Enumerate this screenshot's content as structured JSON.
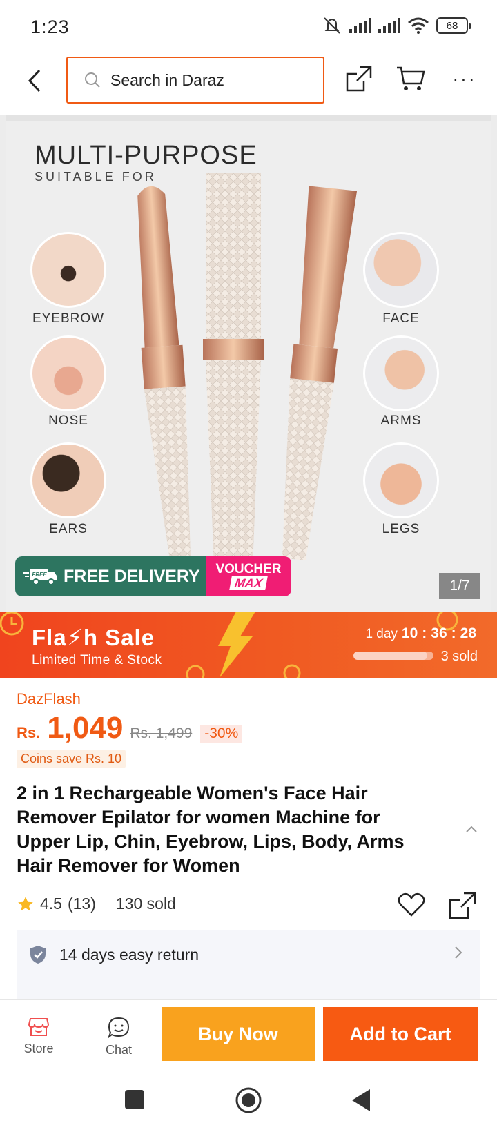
{
  "status_bar": {
    "time": "1:23",
    "battery": "68",
    "icons": [
      "mute-icon",
      "signal-icon",
      "signal-icon",
      "wifi-icon",
      "battery-icon"
    ]
  },
  "search": {
    "placeholder": "Search in Daraz"
  },
  "gallery": {
    "headline": "MULTI-PURPOSE",
    "subhead": "SUITABLE FOR",
    "labels": {
      "eyebrow": "EYEBROW",
      "nose": "NOSE",
      "ears": "EARS",
      "face": "FACE",
      "arms": "ARMS",
      "legs": "LEGS"
    },
    "free_badge": "FREE",
    "free_delivery": "FREE DELIVERY",
    "voucher_line1": "VOUCHER",
    "voucher_line2": "MAX",
    "page_indicator": "1/7"
  },
  "flash_sale": {
    "title": "Fla⚡h Sale",
    "subtitle": "Limited Time & Stock",
    "timer_prefix": "1 day",
    "hours": "10",
    "minutes": "36",
    "seconds": "28",
    "sold": "3 sold",
    "sold_progress": 0.92
  },
  "product": {
    "store": "DazFlash",
    "currency": "Rs.",
    "price": "1,049",
    "old_price": "Rs. 1,499",
    "discount": "-30%",
    "coins": "Coins save Rs. 10",
    "title": "2 in 1 Rechargeable Women's Face Hair Remover Epilator for women Machine for Upper Lip, Chin, Eyebrow, Lips, Body, Arms Hair Remover for Women",
    "rating": "4.5",
    "rating_count": "(13)",
    "sold": "130 sold",
    "return_policy": "14 days easy return"
  },
  "bottom_bar": {
    "store": "Store",
    "chat": "Chat",
    "buy_now": "Buy Now",
    "add_to_cart": "Add to Cart"
  },
  "colors": {
    "accent": "#f05a14",
    "buy_now": "#f9a21e",
    "add_to_cart": "#f75a12",
    "free_delivery": "#2d7560",
    "voucher": "#f01d74"
  }
}
